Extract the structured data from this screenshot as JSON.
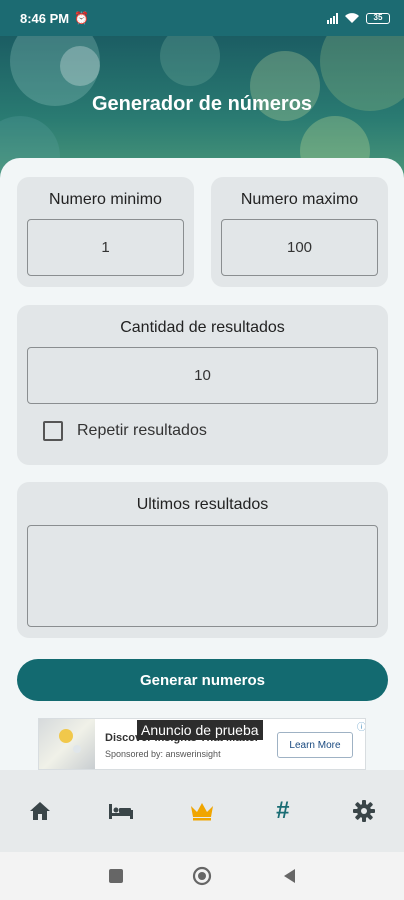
{
  "status_bar": {
    "time": "8:46 PM",
    "battery": "35"
  },
  "header": {
    "title": "Generador de números"
  },
  "min_card": {
    "title": "Numero minimo",
    "value": "1"
  },
  "max_card": {
    "title": "Numero maximo",
    "value": "100"
  },
  "count_card": {
    "title": "Cantidad de resultados",
    "value": "10",
    "repeat_label": "Repetir resultados",
    "repeat_checked": false
  },
  "results_card": {
    "title": "Ultimos resultados",
    "value": ""
  },
  "generate_button": {
    "label": "Generar numeros"
  },
  "ad": {
    "badge": "Anuncio de prueba",
    "headline": "Discover Insights That Matter",
    "sponsor": "Sponsored by: answerinsight",
    "cta": "Learn More"
  },
  "bottom_nav": {
    "items": [
      {
        "icon": "home-icon"
      },
      {
        "icon": "bed-icon"
      },
      {
        "icon": "crown-icon",
        "active": true
      },
      {
        "icon": "hash-icon",
        "symbol": "#"
      },
      {
        "icon": "gear-icon"
      }
    ]
  },
  "colors": {
    "primary": "#136a70",
    "active_icon": "#f0a500",
    "icon_gray": "#3a4548",
    "card_bg": "#e2e6e8"
  }
}
